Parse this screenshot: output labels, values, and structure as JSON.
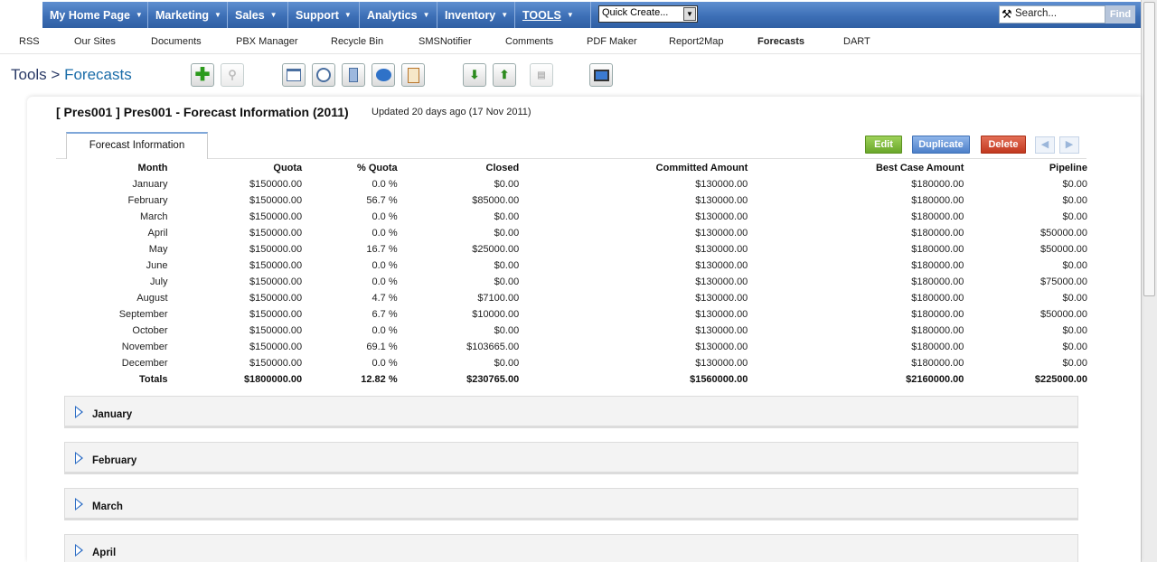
{
  "topnav": {
    "menus": [
      {
        "label": "My Home Page"
      },
      {
        "label": "Marketing"
      },
      {
        "label": "Sales"
      },
      {
        "label": "Support"
      },
      {
        "label": "Analytics"
      },
      {
        "label": "Inventory"
      },
      {
        "label": "TOOLS"
      }
    ],
    "quick_create": "Quick Create...",
    "search_placeholder": "Search...",
    "find_label": "Find"
  },
  "subnav": {
    "items": [
      "RSS",
      "Our Sites",
      "Documents",
      "PBX Manager",
      "Recycle Bin",
      "SMSNotifier",
      "Comments",
      "PDF Maker",
      "Report2Map",
      "Forecasts",
      "DART"
    ],
    "active": "Forecasts"
  },
  "breadcrumb": {
    "root": "Tools",
    "sep": ">",
    "current": "Forecasts"
  },
  "toolbar_icons": [
    "add-icon",
    "search-icon",
    "calendar-icon",
    "clock-icon",
    "calculator-icon",
    "chat-icon",
    "clipboard-icon",
    "import-icon",
    "export-icon",
    "find-duplicates-icon",
    "monitor-icon"
  ],
  "record": {
    "title": "[ Pres001 ] Pres001 - Forecast Information (2011)",
    "updated": "Updated 20 days ago (17 Nov 2011)"
  },
  "tabs": [
    "Forecast Information"
  ],
  "actions": {
    "edit": "Edit",
    "duplicate": "Duplicate",
    "delete": "Delete"
  },
  "table": {
    "headers": [
      "Month",
      "Quota",
      "% Quota",
      "Closed",
      "Committed Amount",
      "Best Case Amount",
      "Pipeline"
    ],
    "rows": [
      [
        "January",
        "$150000.00",
        "0.0 %",
        "$0.00",
        "$130000.00",
        "$180000.00",
        "$0.00"
      ],
      [
        "February",
        "$150000.00",
        "56.7 %",
        "$85000.00",
        "$130000.00",
        "$180000.00",
        "$0.00"
      ],
      [
        "March",
        "$150000.00",
        "0.0 %",
        "$0.00",
        "$130000.00",
        "$180000.00",
        "$0.00"
      ],
      [
        "April",
        "$150000.00",
        "0.0 %",
        "$0.00",
        "$130000.00",
        "$180000.00",
        "$50000.00"
      ],
      [
        "May",
        "$150000.00",
        "16.7 %",
        "$25000.00",
        "$130000.00",
        "$180000.00",
        "$50000.00"
      ],
      [
        "June",
        "$150000.00",
        "0.0 %",
        "$0.00",
        "$130000.00",
        "$180000.00",
        "$0.00"
      ],
      [
        "July",
        "$150000.00",
        "0.0 %",
        "$0.00",
        "$130000.00",
        "$180000.00",
        "$75000.00"
      ],
      [
        "August",
        "$150000.00",
        "4.7 %",
        "$7100.00",
        "$130000.00",
        "$180000.00",
        "$0.00"
      ],
      [
        "September",
        "$150000.00",
        "6.7 %",
        "$10000.00",
        "$130000.00",
        "$180000.00",
        "$50000.00"
      ],
      [
        "October",
        "$150000.00",
        "0.0 %",
        "$0.00",
        "$130000.00",
        "$180000.00",
        "$0.00"
      ],
      [
        "November",
        "$150000.00",
        "69.1 %",
        "$103665.00",
        "$130000.00",
        "$180000.00",
        "$0.00"
      ],
      [
        "December",
        "$150000.00",
        "0.0 %",
        "$0.00",
        "$130000.00",
        "$180000.00",
        "$0.00"
      ]
    ],
    "totals": [
      "Totals",
      "$1800000.00",
      "12.82 %",
      "$230765.00",
      "$1560000.00",
      "$2160000.00",
      "$225000.00"
    ]
  },
  "sections": [
    "January",
    "February",
    "March",
    "April"
  ],
  "colors": {
    "nav": "#3d6fb6",
    "edit": "#6aa72a",
    "duplicate": "#4d80c9",
    "delete": "#c2391f",
    "link": "#1a6ca8"
  }
}
